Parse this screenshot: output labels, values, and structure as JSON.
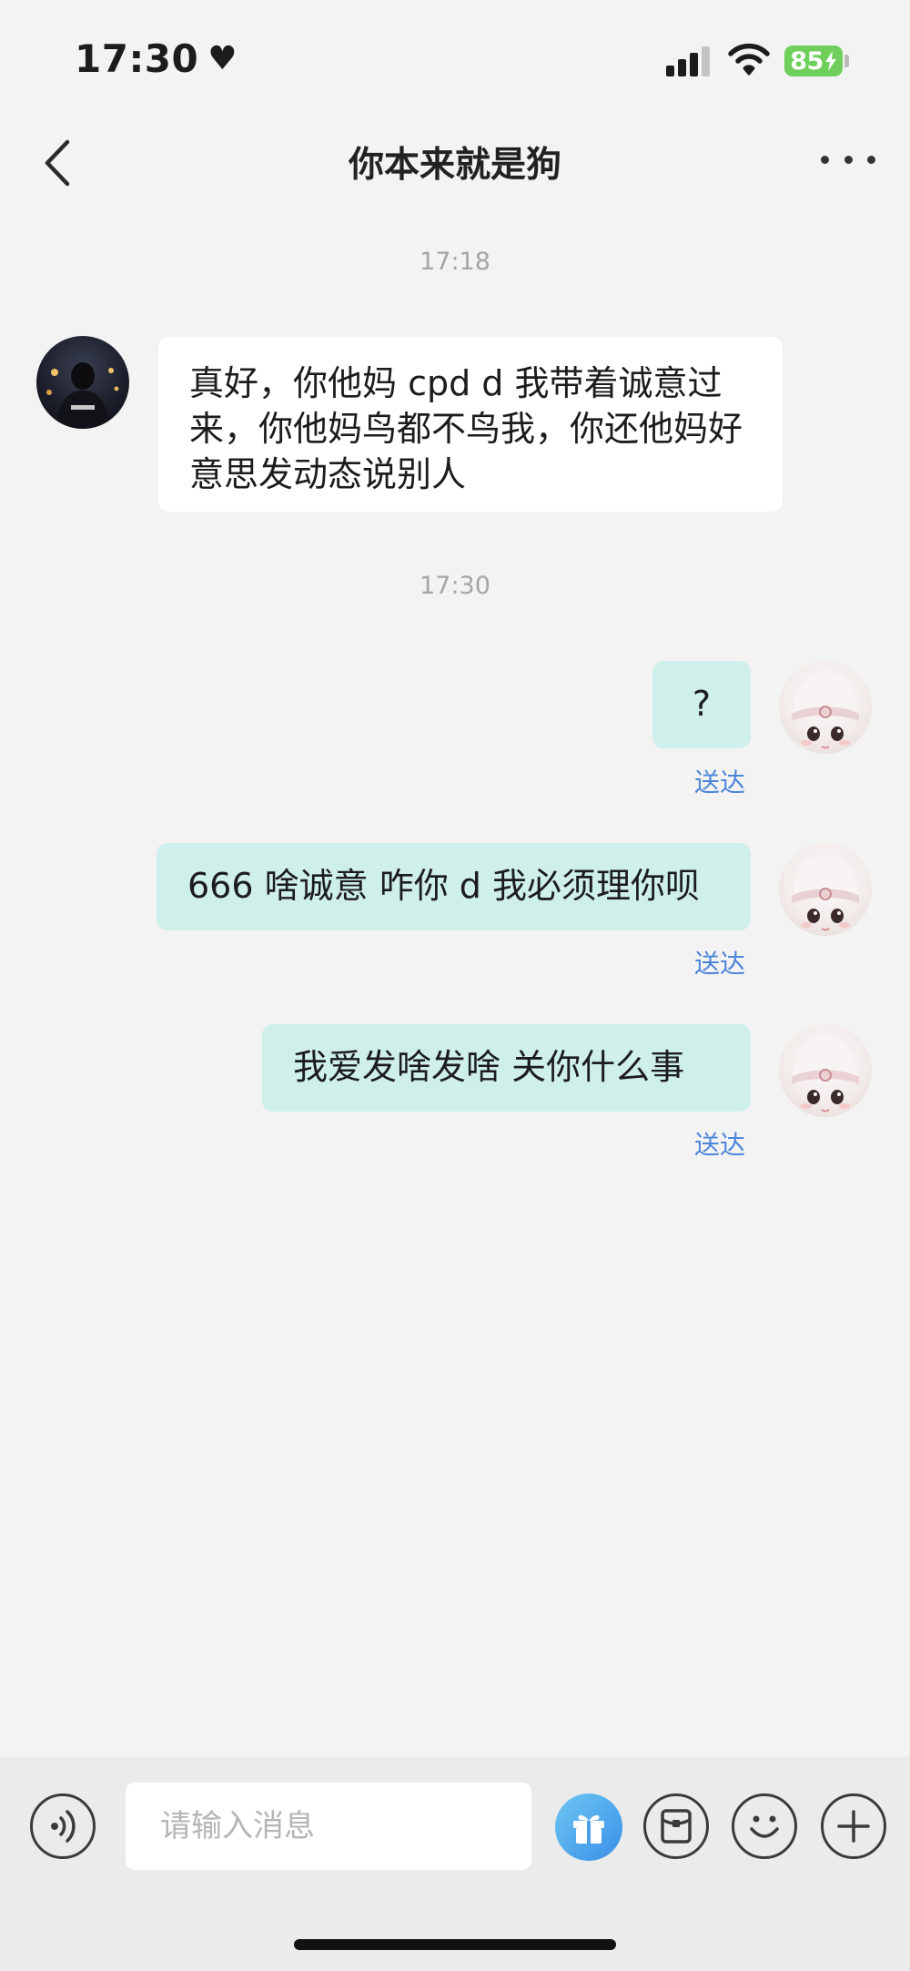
{
  "status_bar": {
    "time": "17:30",
    "heart_glyph": "♥",
    "battery_level": "85",
    "icons": [
      "signal-icon",
      "wifi-icon",
      "battery-charging-icon"
    ]
  },
  "header": {
    "title": "你本来就是狗",
    "back_icon": "chevron-left-icon",
    "more_icon": "more-horizontal-icon"
  },
  "messages": [
    {
      "type": "timestamp",
      "text": "17:18"
    },
    {
      "type": "incoming",
      "text": "真好，你他妈 cpd d 我带着诚意过来，你他妈鸟都不鸟我，你还他妈好意思发动态说别人"
    },
    {
      "type": "timestamp",
      "text": "17:30"
    },
    {
      "type": "outgoing",
      "text": "?",
      "status": "送达"
    },
    {
      "type": "outgoing",
      "text": "666 啥诚意 咋你 d 我必须理你呗",
      "status": "送达"
    },
    {
      "type": "outgoing",
      "text": "我爱发啥发啥 关你什么事",
      "status": "送达"
    }
  ],
  "input_bar": {
    "placeholder": "请输入消息",
    "icons": [
      "voice-icon",
      "gift-icon",
      "red-packet-icon",
      "emoji-icon",
      "plus-icon"
    ]
  },
  "colors": {
    "background": "#f3f3f3",
    "incoming_bubble": "#ffffff",
    "outgoing_bubble": "#cfefea",
    "delivered_text": "#4d86d9",
    "battery": "#6fcf5b",
    "gift_gradient": [
      "#6ec6f2",
      "#3a8fe8"
    ]
  }
}
